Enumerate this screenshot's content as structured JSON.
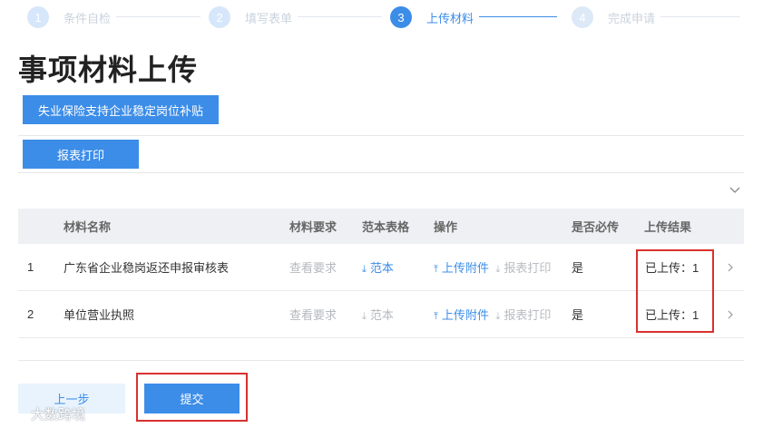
{
  "steps": [
    {
      "num": "1",
      "label": "条件自检"
    },
    {
      "num": "2",
      "label": "填写表单"
    },
    {
      "num": "3",
      "label": "上传材料"
    },
    {
      "num": "4",
      "label": "完成申请"
    }
  ],
  "page_title": "事项材料上传",
  "buttons": {
    "subsidy": "失业保险支持企业稳定岗位补贴",
    "print": "报表打印",
    "prev": "上一步",
    "submit": "提交"
  },
  "table": {
    "headers": {
      "name": "材料名称",
      "requirement": "材料要求",
      "template": "范本表格",
      "operation": "操作",
      "required": "是否必传",
      "result": "上传结果"
    },
    "rows": [
      {
        "index": "1",
        "name": "广东省企业稳岗返还申报审核表",
        "requirement": "查看要求",
        "template": "范本",
        "upload": "上传附件",
        "print": "报表打印",
        "required": "是",
        "result": "已上传：1"
      },
      {
        "index": "2",
        "name": "单位营业执照",
        "requirement": "查看要求",
        "template": "范本",
        "upload": "上传附件",
        "print": "报表打印",
        "required": "是",
        "result": "已上传：1"
      }
    ]
  },
  "watermark": "大数跨境",
  "colors": {
    "accent": "#3c8de8",
    "highlight": "#d9312e"
  }
}
